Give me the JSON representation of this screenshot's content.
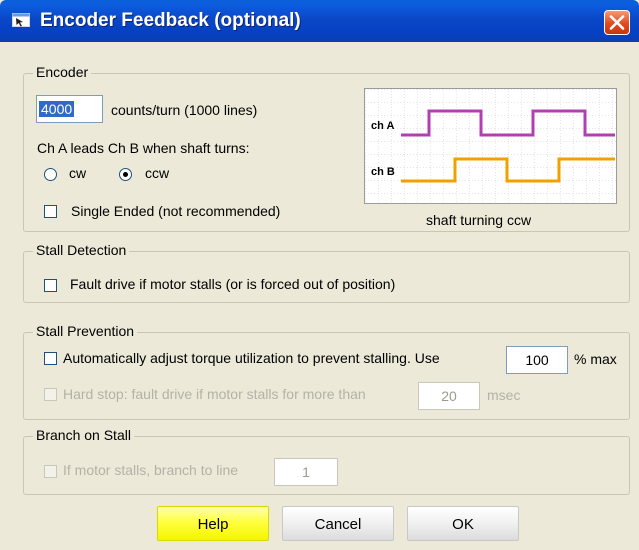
{
  "window": {
    "title": "Encoder Feedback (optional)"
  },
  "encoder": {
    "group_label": "Encoder",
    "counts_value": "4000",
    "counts_label": "counts/turn (1000 lines)",
    "lead_label": "Ch A leads Ch B when shaft turns:",
    "cw_label": "cw",
    "ccw_label": "ccw",
    "selected_direction": "ccw",
    "single_ended_label": "Single Ended (not recommended)",
    "single_ended_checked": false,
    "diagram": {
      "ch_a_label": "ch A",
      "ch_b_label": "ch B",
      "caption": "shaft turning ccw",
      "ch_a_color": "#b040b0",
      "ch_b_color": "#f0a000"
    }
  },
  "stall_detection": {
    "group_label": "Stall Detection",
    "fault_label": "Fault drive if motor stalls (or is forced out of position)",
    "fault_checked": false
  },
  "stall_prevention": {
    "group_label": "Stall Prevention",
    "auto_label": "Automatically adjust torque utilization to prevent stalling. Use",
    "auto_value": "100",
    "auto_unit": "% max",
    "auto_checked": false,
    "hard_stop_label": "Hard stop: fault drive if motor stalls for more than",
    "hard_stop_value": "20",
    "hard_stop_unit": "msec",
    "hard_stop_checked": false
  },
  "branch_on_stall": {
    "group_label": "Branch on Stall",
    "branch_label": "If motor stalls, branch to line",
    "branch_value": "1",
    "branch_checked": false
  },
  "buttons": {
    "help": "Help",
    "cancel": "Cancel",
    "ok": "OK"
  },
  "colors": {
    "titlebar": "#0a48c8",
    "dialog_bg": "#ece9d8",
    "help_button": "#ffff40",
    "close_button": "#e24a1e"
  }
}
